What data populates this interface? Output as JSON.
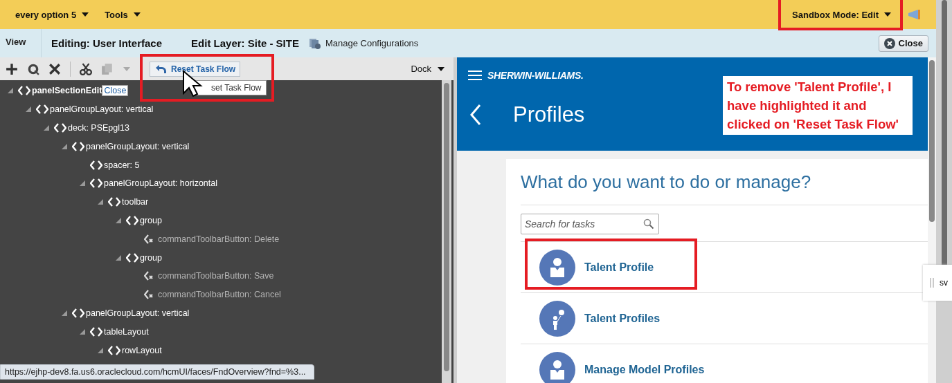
{
  "top_bar": {
    "menus": [
      {
        "label": "every option 5"
      },
      {
        "label": "Tools"
      }
    ],
    "sandbox": {
      "label": "Sandbox Mode: Edit",
      "highlighted": true
    }
  },
  "header": {
    "view": "View",
    "editing": "Editing: User Interface",
    "edit_layer": "Edit Layer: Site - SITE",
    "manage": "Manage Configurations",
    "close": "Close"
  },
  "toolbar": {
    "reset": {
      "label": "Reset Task Flow",
      "highlighted": true
    },
    "tooltip": "set Task Flow",
    "dock": "Dock"
  },
  "tree": [
    {
      "label": "panelSectionEdit",
      "link": "Close",
      "expanded": true,
      "disabled": false,
      "children": [
        {
          "label": "panelGroupLayout: vertical",
          "expanded": true,
          "disabled": false,
          "children": [
            {
              "label": "deck: PSEpgl13",
              "expanded": true,
              "disabled": false,
              "children": [
                {
                  "label": "panelGroupLayout: vertical",
                  "expanded": true,
                  "disabled": false,
                  "children": [
                    {
                      "label": "spacer: 5",
                      "disabled": false
                    },
                    {
                      "label": "panelGroupLayout: horizontal",
                      "expanded": true,
                      "disabled": false,
                      "children": [
                        {
                          "label": "toolbar",
                          "expanded": true,
                          "disabled": false,
                          "children": [
                            {
                              "label": "group",
                              "expanded": true,
                              "disabled": false,
                              "children": [
                                {
                                  "label": "commandToolbarButton: Delete",
                                  "disabled": true
                                }
                              ]
                            },
                            {
                              "label": "group",
                              "expanded": true,
                              "disabled": false,
                              "children": [
                                {
                                  "label": "commandToolbarButton: Save",
                                  "disabled": true
                                },
                                {
                                  "label": "commandToolbarButton: Cancel",
                                  "disabled": true
                                }
                              ]
                            }
                          ]
                        }
                      ]
                    }
                  ]
                },
                {
                  "label": "panelGroupLayout: vertical",
                  "expanded": true,
                  "disabled": false,
                  "children": [
                    {
                      "label": "tableLayout",
                      "expanded": true,
                      "disabled": false,
                      "children": [
                        {
                          "label": "rowLayout",
                          "expanded": true,
                          "disabled": false
                        }
                      ]
                    }
                  ]
                }
              ]
            }
          ]
        }
      ]
    }
  ],
  "status_url": "https://ejhp-dev8.fa.us6.oraclecloud.com/hcmUI/faces/FndOverview?fnd=%3...",
  "preview": {
    "brand": "SHERWIN-WILLIAMS.",
    "title": "Profiles",
    "heading": "What do you want to do or manage?",
    "search": {
      "placeholder": "Search for tasks"
    },
    "tasks": [
      {
        "label": "Talent Profile",
        "kind": "person",
        "highlighted": true
      },
      {
        "label": "Talent Profiles",
        "kind": "balloon",
        "highlighted": false
      },
      {
        "label": "Manage Model Profiles",
        "kind": "person",
        "highlighted": false
      }
    ],
    "side_tab": "sv"
  },
  "annotation": {
    "note": "To remove 'Talent Profile', I have highlighted it and clicked on 'Reset Task Flow'"
  }
}
